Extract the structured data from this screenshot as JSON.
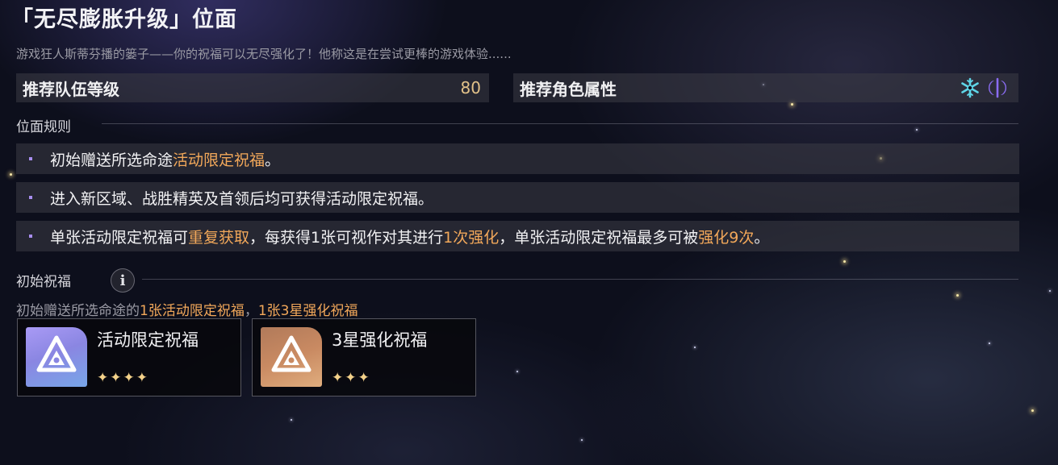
{
  "header": {
    "title": "「无尽膨胀升级」位面",
    "subtitle": "游戏狂人斯蒂芬播的篓子——你的祝福可以无尽强化了！他称这是在尝试更棒的游戏体验......"
  },
  "recommend": {
    "level_label": "推荐队伍等级",
    "level_value": "80",
    "attr_label": "推荐角色属性",
    "attr_icons": [
      "ice-element-icon",
      "imaginary-element-icon"
    ],
    "ice_color": "#5fd6e8",
    "imaginary_color": "#8a6cf2"
  },
  "rules": {
    "heading": "位面规则",
    "items": [
      {
        "parts": [
          "初始赠送所选命途",
          "活动限定祝福",
          "。"
        ]
      },
      {
        "parts": [
          "进入新区域、战胜精英及首领后均可获得活动限定祝福。"
        ]
      },
      {
        "parts": [
          "单张活动限定祝福可",
          "重复获取",
          "，每获得1张可视作对其进行",
          "1次强化",
          "，单张活动限定祝福最多可被",
          "强化9次",
          "。"
        ]
      }
    ],
    "highlight_color": "#f2a85a"
  },
  "initial": {
    "heading": "初始祝福",
    "info_icon": "info-icon",
    "desc_prefix": "初始赠送所选命途的",
    "desc_hl1": "1张活动限定祝福",
    "desc_sep": "，",
    "desc_hl2": "1张3星强化祝福",
    "cards": [
      {
        "name": "活动限定祝福",
        "stars": "✦✦✦✦",
        "rarity": 4,
        "icon": "blessing-emblem-icon",
        "color": "#8f8fe6"
      },
      {
        "name": "3星强化祝福",
        "stars": "✦✦✦",
        "rarity": 3,
        "icon": "blessing-emblem-icon",
        "color": "#c98a62"
      }
    ]
  }
}
